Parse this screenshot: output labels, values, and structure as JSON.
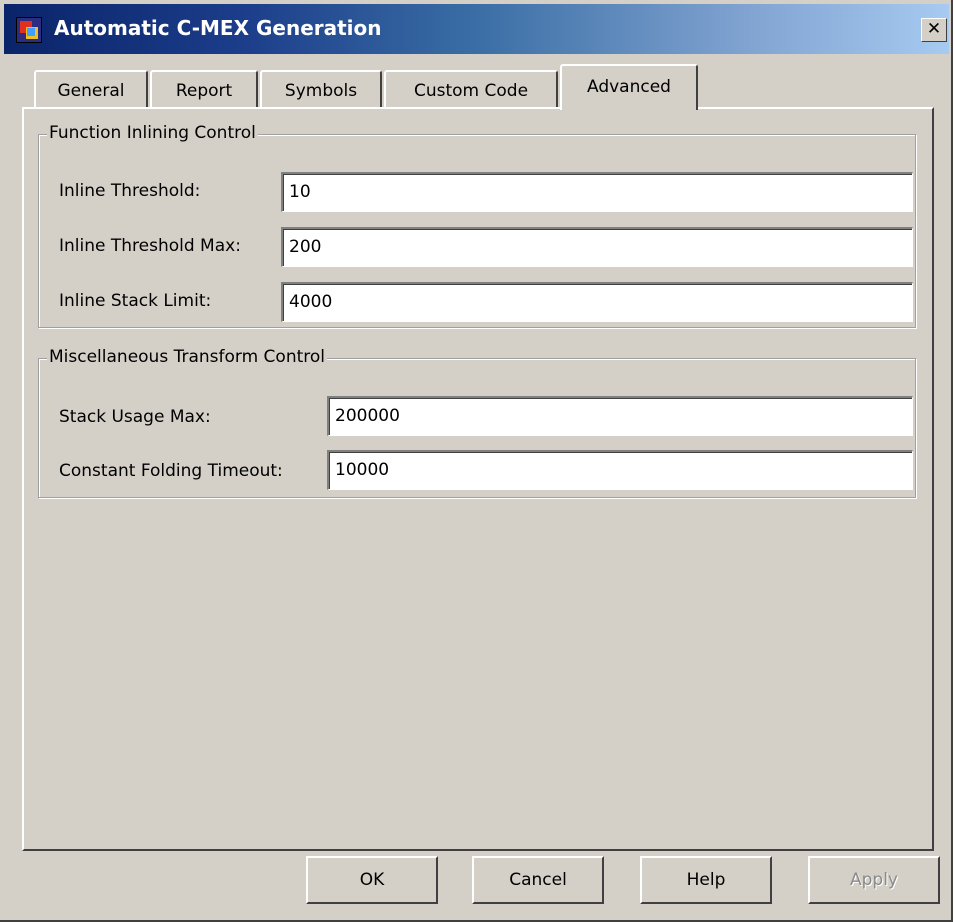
{
  "window": {
    "title": "Automatic C-MEX Generation",
    "close_label": "✕"
  },
  "tabs": [
    {
      "label": "General"
    },
    {
      "label": "Report"
    },
    {
      "label": "Symbols"
    },
    {
      "label": "Custom Code"
    },
    {
      "label": "Advanced",
      "active": true
    }
  ],
  "inlining": {
    "title": "Function Inlining Control",
    "threshold_label": "Inline Threshold:",
    "threshold_value": "10",
    "threshold_max_label": "Inline Threshold Max:",
    "threshold_max_value": "200",
    "stack_limit_label": "Inline Stack Limit:",
    "stack_limit_value": "4000"
  },
  "misc": {
    "title": "Miscellaneous Transform Control",
    "stack_usage_label": "Stack Usage Max:",
    "stack_usage_value": "200000",
    "folding_timeout_label": "Constant Folding Timeout:",
    "folding_timeout_value": "10000"
  },
  "buttons": {
    "ok": "OK",
    "cancel": "Cancel",
    "help": "Help",
    "apply": "Apply"
  }
}
